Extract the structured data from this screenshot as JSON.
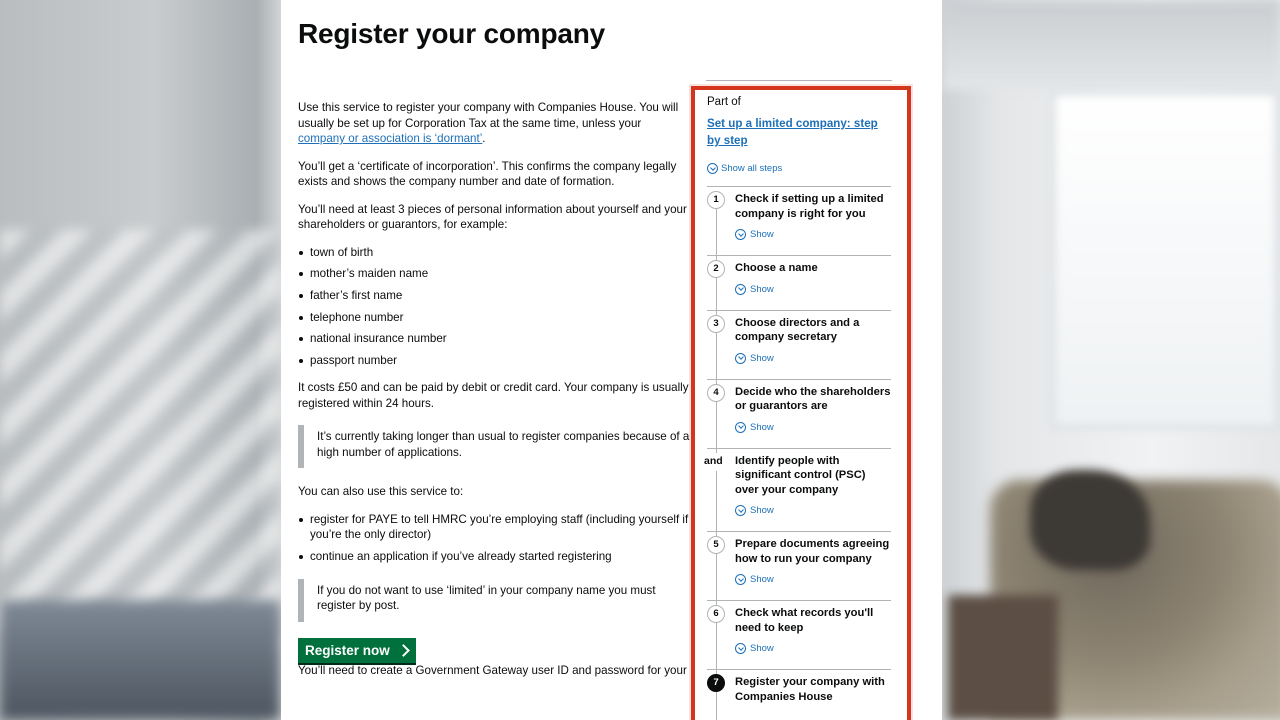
{
  "title": "Register your company",
  "intro": {
    "p1_text": "Use this service to register your company with Companies House. You will usually be set up for Corporation Tax at the same time, unless your ",
    "p1_link": "company or association is ‘dormant’",
    "p1_end": ".",
    "p2": "You’ll get a ‘certificate of incorporation’. This confirms the company legally exists and shows the company number and date of formation.",
    "p3": "You’ll need at least 3 pieces of personal information about yourself and your shareholders or guarantors, for example:",
    "info_items": [
      "town of birth",
      "mother’s maiden name",
      "father’s first name",
      "telephone number",
      "national insurance number",
      "passport number"
    ],
    "p4": "It costs £50 and can be paid by debit or credit card. Your company is usually registered within 24 hours.",
    "inset1": "It’s currently taking longer than usual to register companies because of a high number of applications.",
    "p5": "You can also use this service to:",
    "also_items": [
      "register for PAYE to tell HMRC you’re employing staff (including yourself if you’re the only director)",
      "continue an application if you’ve already started registering"
    ],
    "inset2": "If you do not want to use ‘limited’ in your company name you must register by post.",
    "button_label": "Register now",
    "trailing": "You’ll need to create a Government Gateway user ID and password for your"
  },
  "sidebar": {
    "part_of": "Part of",
    "link": "Set up a limited company: step by step",
    "show_all": "Show all steps",
    "show_label": "Show",
    "steps": [
      {
        "marker": "1",
        "title": "Check if setting up a limited company is right for you"
      },
      {
        "marker": "2",
        "title": "Choose a name"
      },
      {
        "marker": "3",
        "title": "Choose directors and a company secretary"
      },
      {
        "marker": "4",
        "title": "Decide who the shareholders or guarantors are"
      },
      {
        "marker": "and",
        "title": "Identify people with significant control (PSC) over your company"
      },
      {
        "marker": "5",
        "title": "Prepare documents agreeing how to run your company"
      },
      {
        "marker": "6",
        "title": "Check what records you'll need to keep"
      },
      {
        "marker": "7",
        "title": "Register your company with Companies House"
      }
    ]
  },
  "colors": {
    "link": "#1d70b8",
    "button": "#00703c",
    "highlight": "#d4351c",
    "text": "#0b0c0c"
  }
}
